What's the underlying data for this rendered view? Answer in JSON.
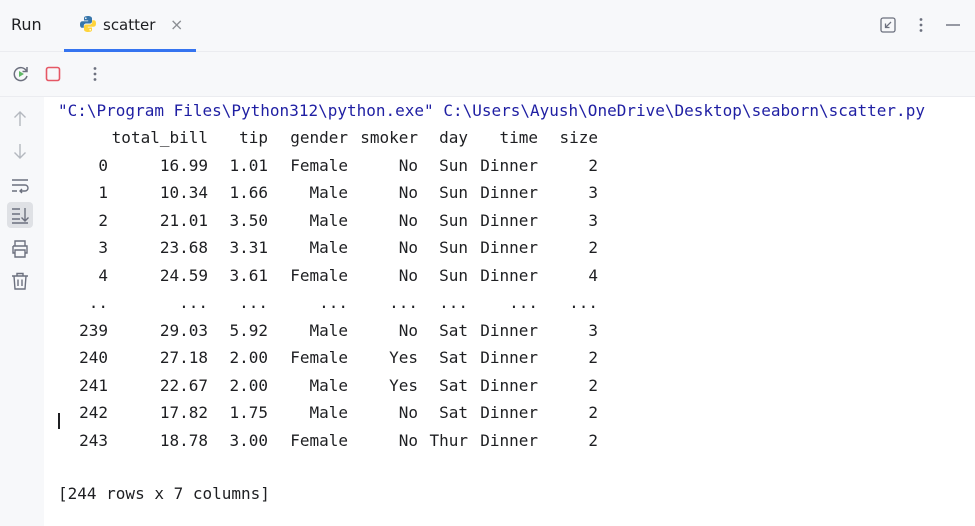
{
  "header": {
    "run_title": "Run",
    "tab_label": "scatter",
    "tab_icon": "python-icon",
    "close_glyph": "×"
  },
  "colors": {
    "accent": "#3574f0",
    "command_text": "#1f1fa3",
    "stop_red": "#e55765",
    "rerun_green": "#5fb865"
  },
  "console": {
    "command": "\"C:\\Program Files\\Python312\\python.exe\" C:\\Users\\Ayush\\OneDrive\\Desktop\\seaborn\\scatter.py",
    "columns": [
      "",
      "total_bill",
      "tip",
      "gender",
      "smoker",
      "day",
      "time",
      "size"
    ],
    "rows": [
      [
        "0",
        "16.99",
        "1.01",
        "Female",
        "No",
        "Sun",
        "Dinner",
        "2"
      ],
      [
        "1",
        "10.34",
        "1.66",
        "Male",
        "No",
        "Sun",
        "Dinner",
        "3"
      ],
      [
        "2",
        "21.01",
        "3.50",
        "Male",
        "No",
        "Sun",
        "Dinner",
        "3"
      ],
      [
        "3",
        "23.68",
        "3.31",
        "Male",
        "No",
        "Sun",
        "Dinner",
        "2"
      ],
      [
        "4",
        "24.59",
        "3.61",
        "Female",
        "No",
        "Sun",
        "Dinner",
        "4"
      ],
      [
        "..",
        "...",
        "...",
        "...",
        "...",
        "...",
        "...",
        "..."
      ],
      [
        "239",
        "29.03",
        "5.92",
        "Male",
        "No",
        "Sat",
        "Dinner",
        "3"
      ],
      [
        "240",
        "27.18",
        "2.00",
        "Female",
        "Yes",
        "Sat",
        "Dinner",
        "2"
      ],
      [
        "241",
        "22.67",
        "2.00",
        "Male",
        "Yes",
        "Sat",
        "Dinner",
        "2"
      ],
      [
        "242",
        "17.82",
        "1.75",
        "Male",
        "No",
        "Sat",
        "Dinner",
        "2"
      ],
      [
        "243",
        "18.78",
        "3.00",
        "Female",
        "No",
        "Thur",
        "Dinner",
        "2"
      ]
    ],
    "summary": "[244 rows x 7 columns]"
  }
}
